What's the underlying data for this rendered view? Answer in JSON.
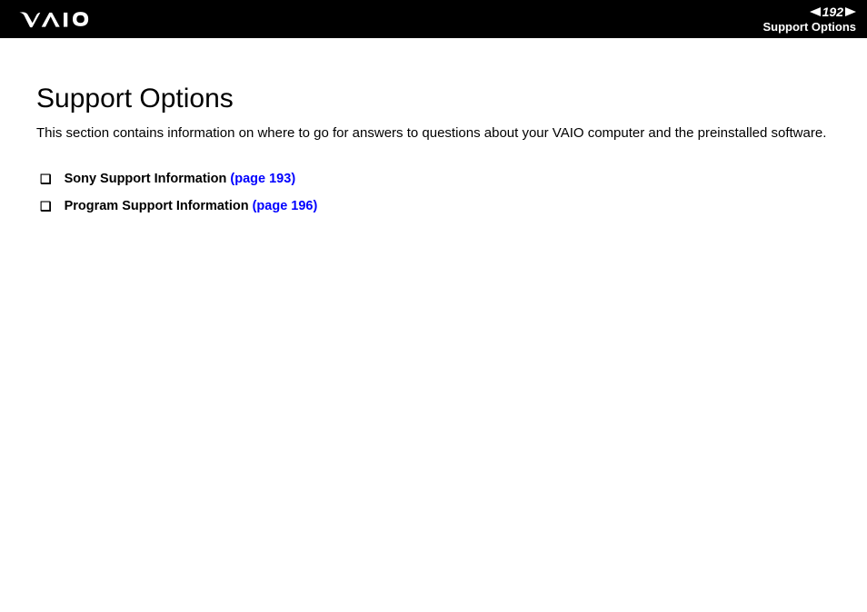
{
  "header": {
    "page_number": "192",
    "breadcrumb": "Support Options"
  },
  "content": {
    "title": "Support Options",
    "intro": "This section contains information on where to go for answers to questions about your VAIO computer and the preinstalled software.",
    "items": [
      {
        "label": "Sony Support Information ",
        "link": "(page 193)"
      },
      {
        "label": "Program Support Information ",
        "link": "(page 196)"
      }
    ]
  }
}
